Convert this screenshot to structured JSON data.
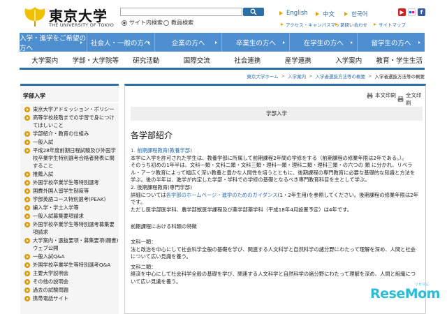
{
  "header": {
    "logo_jp": "東京大学",
    "logo_en": "THE UNIVERSITY OF TOKYO",
    "search_placeholder": "",
    "radio_site": "サイト内検索",
    "radio_staff": "教員検索",
    "languages": [
      "English",
      "中文",
      "한국어"
    ],
    "sub_links": [
      "アクセス・キャンパスマップ",
      "お問い合わせ",
      "サイトマップ"
    ],
    "social": [
      "YouTube",
      "Flickr",
      "Facebook"
    ]
  },
  "nav_primary": [
    "入学・進学をご希望の方へ",
    "社会人・一般の方へ",
    "企業の方へ",
    "卒業生の方へ",
    "在学生の方へ",
    "留学生の方へ"
  ],
  "nav_secondary": [
    "大学案内",
    "学部・大学院等",
    "研究活動",
    "国際交流",
    "社会連携",
    "産学連携",
    "入学案内",
    "教育・学生生活"
  ],
  "breadcrumb": [
    "東京大学ホーム",
    "入学案内",
    "入学者選抜方法等の概要",
    "入学者選抜方法等の概要"
  ],
  "sidebar": {
    "title": "学部入学",
    "items": [
      "東京大学アドミッション・ポリシー",
      "高等学校段階までの学習で身につけてほしいこと",
      "学部紹介・教育の仕組み",
      "一般入試",
      "平成28年度前期日程試験及び外国学校卒業学生特別選考合格者発表に関すること",
      "推薦入試",
      "外国学校卒業学生等特別選考",
      "国費外国人留学生制度等",
      "学部英語コース特別選考(PEAK)",
      "編入学・学士入学等",
      "一般入試募集要項請求",
      "外国学校卒業学生等特別選考募集要項請求",
      "大学案内・選抜要項・募集要項(願書)ウェブ公開",
      "一般入試Q&A",
      "外国学校卒業学生等特別選考Q&A",
      "主要大学説明会",
      "その他の説明会",
      "過去の試験問題",
      "携帯電話サイト"
    ]
  },
  "main": {
    "print_body": "本文印刷",
    "print_all": "全文印刷",
    "section_title": "学部入学",
    "heading": "各学部紹介",
    "item1_head": "1. 前期課程教育(教養学部)",
    "item1_p1": "本学に入学を許可された学生は、教養学部に所属して前期課程2年間の学修をする（前期課程の修業年限は2年である。）。",
    "item1_p2": "そのうち初めの1年半は、文科一類・文科二類・文科三類・理科一類・理科二類・理科三類・の六つの 類 に分かれ、リベラル・アーツ教育によって幅広く深い教養と豊かな人間性を培うとともに、後期課程の専門教育に必要な基礎的な知識と方法を学ぶ。後の半年は、進学が内定した学部・学科での学修の基礎となるべき専門教育科目を主として学ぶ。",
    "item2_head": "2. 後期課程教育(専門学部)",
    "item2_p1_a": "詳細については",
    "item2_p1_link": "各学部のホームページ・進学のためのガイダンス",
    "item2_p1_b": "(1・2年生用)を参照してください。後期課程の修業年限は2年です。",
    "item2_p2": "ただし医学部医学科、農学部獣医学課程及び薬学部薬学科（平成18年4月設置予定）は4年です。",
    "sub_heading": "前期課程における科類の特徴",
    "k1_label": "文科一類：",
    "k1_text": "法と政治を中心にして社会科学全般の基礎を学び、関連する人文科学と自然科学の諸分野にわたって理解を深め、人間と社会について広い見識を養う。",
    "k2_label": "文科二類：",
    "k2_text": "経済を中心にして社会科学全般の基礎を学び、関連する人文科学と自然科学の諸分野にわたって理解を深め、人間と組織について広い見識を養う。"
  },
  "watermark": {
    "brand": "ReseMom",
    "small": "リセマム"
  },
  "colors": {
    "nav_blue": "#4f8fd0",
    "accent_blue": "#2d6da8",
    "bullet_orange": "#e09a00",
    "link_blue": "#2a6aa8",
    "watermark": "#29bcd9"
  }
}
